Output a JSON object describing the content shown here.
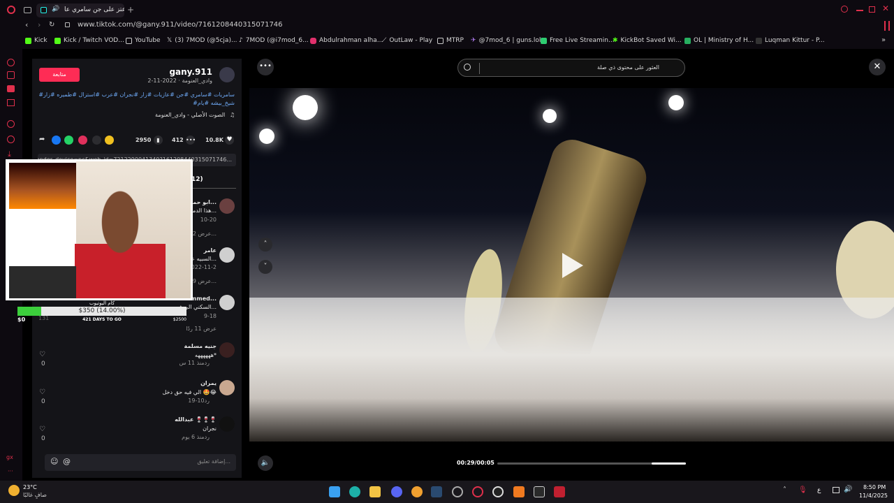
{
  "browser": {
    "tab_title": "اعتز على جن سامري عا...",
    "url": "www.tiktok.com/@gany.911/video/7161208440315071746",
    "bookmarks": [
      {
        "label": "Kick",
        "color": "#53fc18"
      },
      {
        "label": "Kick / Twitch VOD...",
        "color": "#53fc18"
      },
      {
        "label": "YouTube",
        "color": "#dddddd"
      },
      {
        "label": "(3) 7MOD (@5cja)...",
        "color": "#dddddd"
      },
      {
        "label": "7MOD (@i7mod_6...",
        "color": "#dddddd"
      },
      {
        "label": "Abdulrahman alha...",
        "color": "#e1306c"
      },
      {
        "label": "OutLaw - Play",
        "color": "#aaaaaa"
      },
      {
        "label": "MTRP",
        "color": "#dddddd"
      },
      {
        "label": "@7mod_6 | guns.lol",
        "color": "#b07cf0"
      },
      {
        "label": "Free Live Streamin...",
        "color": "#2ecc71"
      },
      {
        "label": "KickBot Saved Wi...",
        "color": "#53fc18"
      },
      {
        "label": "OL | Ministry of H...",
        "color": "#27ae60"
      },
      {
        "label": "Luqman Kittur - P...",
        "color": "#333333"
      }
    ]
  },
  "post": {
    "username": "gany.911",
    "subtitle": "وادي_العنومة · 2022-11-2",
    "follow_label": "متابعة",
    "hashtags_line1": "#سامريات #سامري #جن #عازيات #زار #نجران #عرب #استزال #طميره #زار",
    "hashtags_line2": "#شيخ_بيشه #يام",
    "sound": "الصوت الأصلي - وادي_العنومة",
    "likes": "10.8K",
    "comments": "412",
    "saves": "2950",
    "link_text": "...161208440315071746?is_from_webapp=1&sender_device=pc&web_id=7212290041349",
    "comments_tab": "12)"
  },
  "comments": [
    {
      "name": "ابو حمد ال...",
      "text": "هذا الدمله ال...",
      "date": "10-20",
      "replies": "عرض 2 ر..."
    },
    {
      "name": "عامر",
      "text": "السبيه عي...",
      "date": "2022-11-2",
      "replies": "عرض 9 ر..."
    },
    {
      "name": "mmed...",
      "text": "السكني الي فيه...",
      "date": "9-18",
      "replies": "عرض 11 ردًا"
    },
    {
      "name": "جنيه مسلمة",
      "text": "ههههههه*",
      "date": "منذ 11 س",
      "reply": "رد",
      "likes": "0"
    },
    {
      "name": "يمران",
      "text": "الي فيه حق دخل 🤩😂",
      "date": "10-19",
      "reply": "رد",
      "likes": "0"
    },
    {
      "name": "عبدالله 🍷🍷🍷",
      "text": "نجران",
      "date": "منذ 6 يوم",
      "reply": "رد",
      "likes": "0"
    }
  ],
  "comment_input": {
    "placeholder": "إضافة تعليق..."
  },
  "overlay": {
    "goal_title": "كام اليوتيوب",
    "goal_amount": "$350 (14.00%)",
    "goal_progress": 0.14,
    "goal_min": "$0",
    "goal_max": "$2500",
    "days_left": "421 DAYS TO GO",
    "goal_count": "131"
  },
  "video": {
    "search_text": "العثور على محتوى ذي صلة",
    "time": "00:29/00:05",
    "progress": 0.82
  },
  "taskbar": {
    "weather_temp": "23°C",
    "weather_text": "صافٍ غالبًا",
    "time": "8:50 PM",
    "date": "11/4/2025",
    "lang": "ع"
  }
}
